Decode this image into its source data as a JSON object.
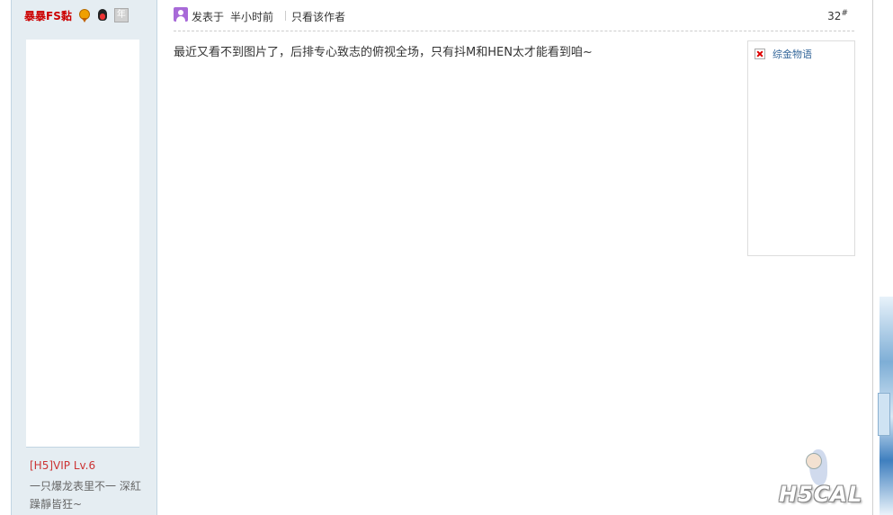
{
  "author": {
    "name": "暴暴FS黏",
    "medals": [
      "award-medal-icon",
      "penguin-icon",
      "gray-badge-icon"
    ],
    "medal_gray_text": "年",
    "group_title": "[H5]VIP Lv.6",
    "signature": "一只爆龙表里不一 深紅躁靜皆狂~"
  },
  "post": {
    "posted_label": "发表于",
    "posted_time": "半小时前",
    "only_author": "只看该作者",
    "floor": "32",
    "floor_sup": "#",
    "content": "最近又看不到图片了，后排专心致志的俯视全场，只有抖M和HEN太才能看到咱~"
  },
  "ad": {
    "text": "综金物语"
  },
  "watermark": {
    "text": "H5CAL"
  },
  "colors": {
    "author_name": "#cc0000",
    "group_title": "#cc3333",
    "sidebar_bg": "#e5edf2",
    "user_icon": "#a86ad8"
  }
}
